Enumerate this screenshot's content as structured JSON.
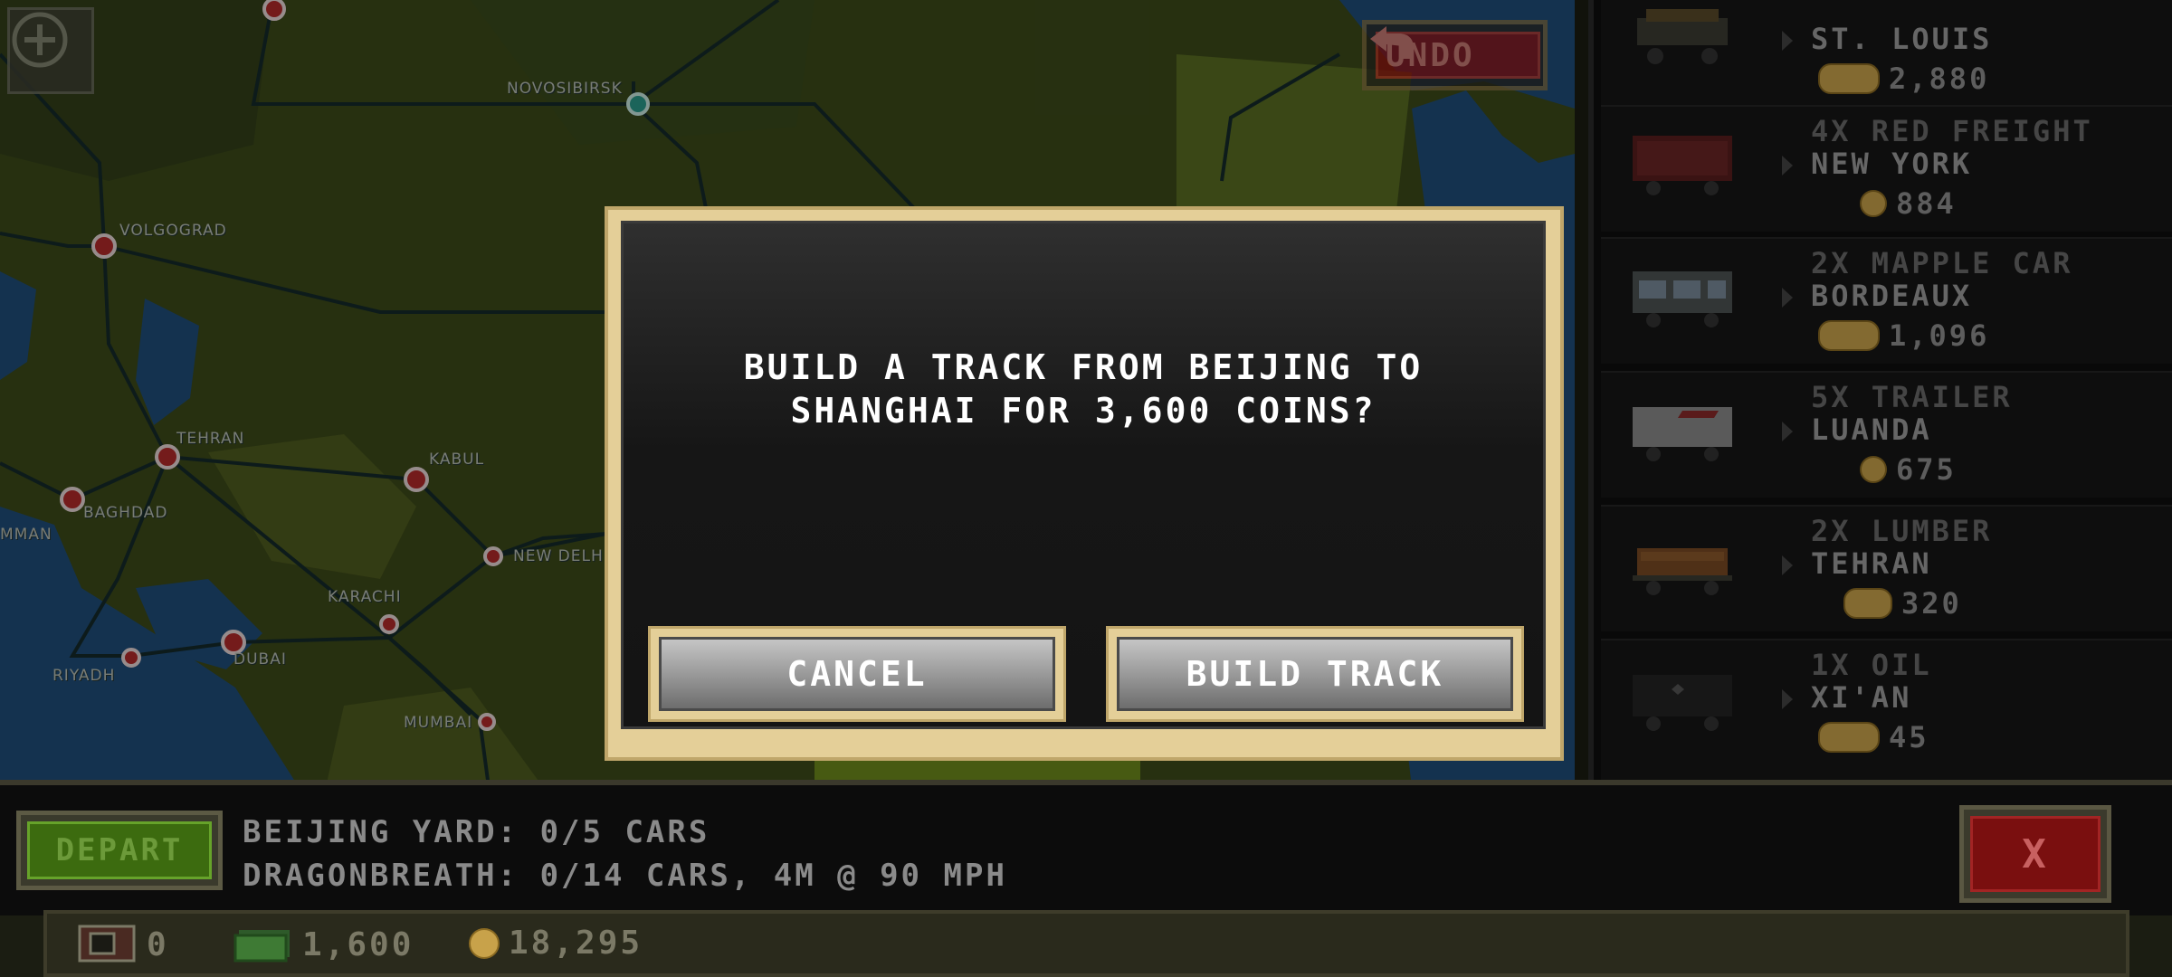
{
  "map": {
    "cities": [
      "NOVOSIBIRSK",
      "VOLGOGRAD",
      "TEHRAN",
      "KABUL",
      "BAGHDAD",
      "MMAN",
      "NEW DELH",
      "KARACHI",
      "RIYADH",
      "DUBAI",
      "MUMBAI"
    ],
    "undo_label": "UNDO"
  },
  "side_panel": {
    "cards": [
      {
        "title": "",
        "dest": "ST. LOUIS",
        "pay": "2,880"
      },
      {
        "title": "4X RED FREIGHT",
        "dest": "NEW YORK",
        "pay": "884"
      },
      {
        "title": "2X MAPPLE CAR",
        "dest": "BORDEAUX",
        "pay": "1,096"
      },
      {
        "title": "5X TRAILER",
        "dest": "LUANDA",
        "pay": "675"
      },
      {
        "title": "2X LUMBER",
        "dest": "TEHRAN",
        "pay": "320"
      },
      {
        "title": "1X OIL",
        "dest": "XI'AN",
        "pay": "45"
      }
    ]
  },
  "dialog": {
    "line1": "BUILD A TRACK FROM BEIJING TO",
    "line2": "SHANGHAI FOR 3,600 COINS?",
    "cancel_label": "CANCEL",
    "confirm_label": "BUILD TRACK"
  },
  "bottom": {
    "depart_label": "DEPART",
    "yard_line": "BEIJING YARD: 0/5 CARS",
    "train_line": "DRAGONBREATH: 0/14 CARS, 4M @ 90 MPH",
    "close_label": "X"
  },
  "status": {
    "cars": "0",
    "cash": "1,600",
    "coins": "18,295"
  },
  "colors": {
    "dialog_border": "#e4cf98",
    "button_gray": "#9a9a9a",
    "land": "#3c4a1a",
    "water": "#1e4d78"
  }
}
